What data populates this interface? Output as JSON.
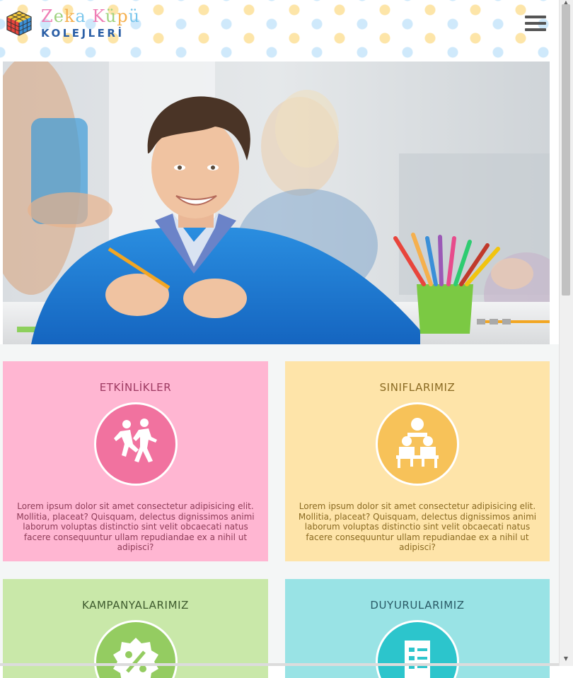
{
  "header": {
    "logo_title": "Zeka Küpü",
    "logo_subtitle": "KOLEJLERİ",
    "menu_icon": "hamburger-menu-icon"
  },
  "hero": {
    "slide_count": 3
  },
  "cards": [
    {
      "title": "ETKİNLİKLER",
      "icon": "children-running-icon",
      "text": "Lorem ipsum dolor sit amet consectetur adipisicing elit. Mollitia, placeat? Quisquam, delectus dignissimos animi laborum voluptas distinctio sint velit obcaecati natus facere consequuntur ullam repudiandae ex a nihil ut adipisci?"
    },
    {
      "title": "SINIFLARIMIZ",
      "icon": "classroom-desk-icon",
      "text": "Lorem ipsum dolor sit amet consectetur adipisicing elit. Mollitia, placeat? Quisquam, delectus dignissimos animi laborum voluptas distinctio sint velit obcaecati natus facere consequuntur ullam repudiandae ex a nihil ut adipisci?"
    },
    {
      "title": "KAMPANYALARIMIZ",
      "icon": "percent-discount-icon"
    },
    {
      "title": "DUYURULARIMIZ",
      "icon": "announcement-document-icon"
    }
  ],
  "colors": {
    "pink": "#ffb6d2",
    "yellow": "#fee4a9",
    "green": "#c9e8a9",
    "cyan": "#99e3e5"
  }
}
